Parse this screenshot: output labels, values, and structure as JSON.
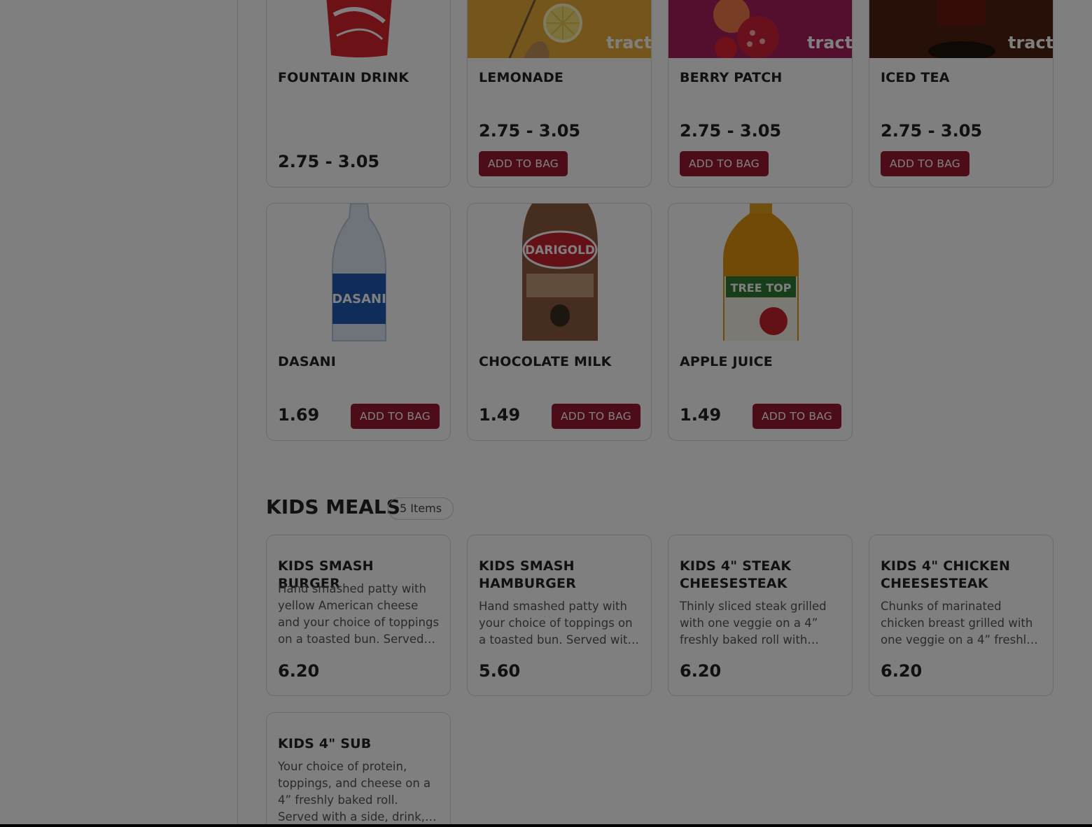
{
  "colors": {
    "accent": "#9b1b30",
    "overlay": "rgba(0,0,0,0.5)"
  },
  "brand_watermark": "tracto",
  "drinks": [
    {
      "name": "FOUNTAIN DRINK",
      "price": "2.75 - 3.05",
      "image": "coca-cola-cup-image"
    },
    {
      "name": "LEMONADE",
      "price": "2.75 - 3.05",
      "button": "ADD TO BAG",
      "image": "lemonade-image"
    },
    {
      "name": "BERRY PATCH",
      "price": "2.75 - 3.05",
      "button": "ADD TO BAG",
      "image": "berry-patch-image"
    },
    {
      "name": "ICED TEA",
      "price": "2.75 - 3.05",
      "button": "ADD TO BAG",
      "image": "iced-tea-image"
    },
    {
      "name": "DASANI",
      "price": "1.69",
      "button": "ADD TO BAG",
      "image": "dasani-bottle-image",
      "label": "DASANI"
    },
    {
      "name": "CHOCOLATE MILK",
      "price": "1.49",
      "button": "ADD TO BAG",
      "image": "darigold-chocolate-milk-image",
      "label": "DARIGOLD"
    },
    {
      "name": "APPLE JUICE",
      "price": "1.49",
      "button": "ADD TO BAG",
      "image": "tree-top-apple-juice-image",
      "label": "TREE TOP"
    }
  ],
  "kids_meals": {
    "title": "KIDS MEALS",
    "count": "5 Items",
    "items": [
      {
        "name": "KIDS SMASH BURGER",
        "desc": "Hand smashed patty with yellow American cheese and your choice of toppings on a toasted bun. Served with a side, drink, and a free scoop.",
        "price": "6.20"
      },
      {
        "name": "KIDS SMASH HAMBURGER",
        "desc": "Hand smashed patty with your choice of toppings on a toasted bun. Served with a side, drink, and a free scoop.",
        "price": "5.60"
      },
      {
        "name": "KIDS 4\" STEAK CHEESESTEAK",
        "desc": "Thinly sliced steak grilled with one veggie on a 4” freshly baked roll with melted white cheese.",
        "price": "6.20"
      },
      {
        "name": "KIDS 4\" CHICKEN CHEESESTEAK",
        "desc": "Chunks of marinated chicken breast grilled with one veggie on a 4” freshly baked roll with melted cheese.",
        "price": "6.20"
      },
      {
        "name": "KIDS 4\" SUB",
        "desc": "Your choice of protein, toppings, and cheese on a 4” freshly baked roll. Served with a side, drink, and a free scoop.",
        "price": ""
      }
    ]
  }
}
